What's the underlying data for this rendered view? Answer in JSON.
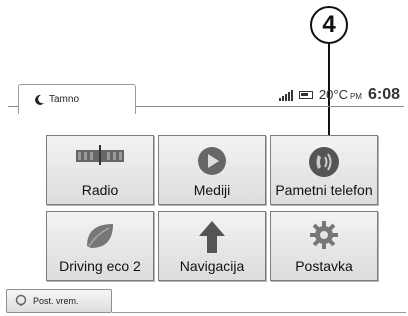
{
  "callout": {
    "number": "4"
  },
  "status": {
    "mode_label": "Tamno",
    "temperature": "20°C",
    "ampm": "PM",
    "time": "6:08"
  },
  "tiles": [
    {
      "label": "Radio",
      "icon": "radio-icon"
    },
    {
      "label": "Mediji",
      "icon": "play-icon"
    },
    {
      "label": "Pametni telefon",
      "icon": "smartphone-voice-icon"
    },
    {
      "label": "Driving eco 2",
      "icon": "eco-leaf-icon"
    },
    {
      "label": "Navigacija",
      "icon": "navigation-arrow-icon"
    },
    {
      "label": "Postavka",
      "icon": "gear-icon"
    }
  ],
  "bottom_button": {
    "label": "Post. vrem.",
    "icon": "settings-ring-icon"
  }
}
